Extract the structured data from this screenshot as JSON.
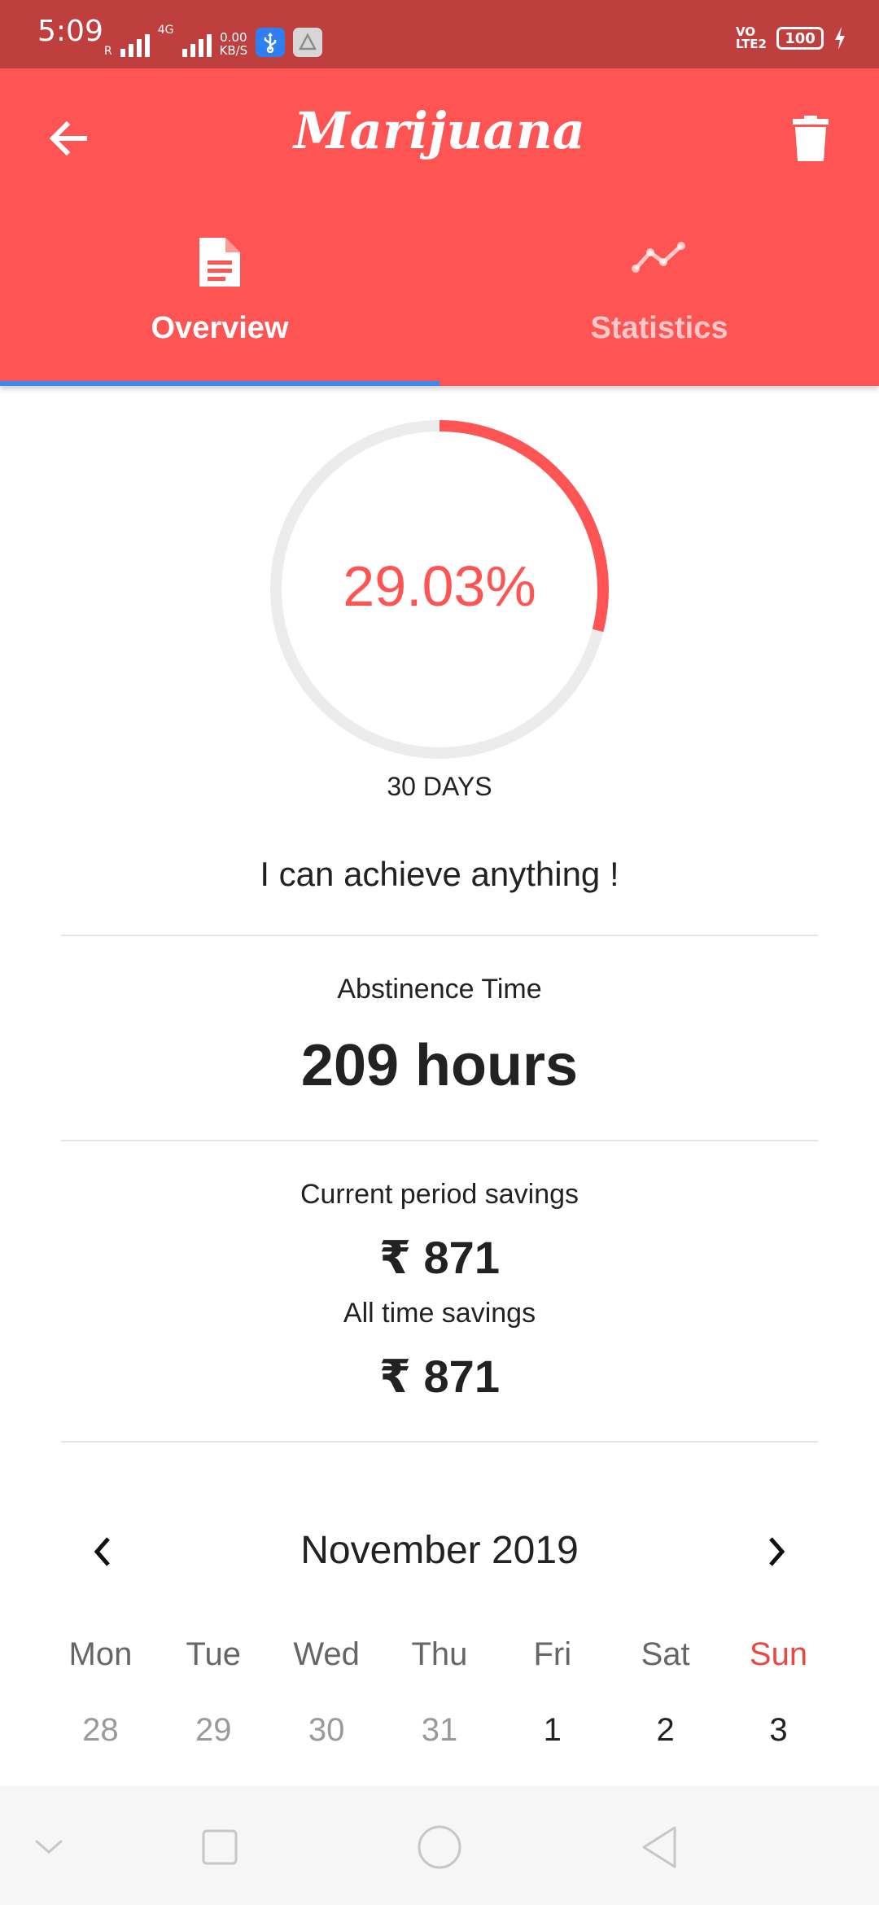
{
  "status_bar": {
    "time": "5:09",
    "sim1_label": "R",
    "network_type": "4G",
    "speed_value": "0.00",
    "speed_unit": "KB/S",
    "volte": "VO",
    "volte_sub": "LTE2",
    "battery": "100"
  },
  "app_bar": {
    "title": "Marijuana",
    "tabs": [
      {
        "label": "Overview",
        "icon": "document-icon",
        "active": true
      },
      {
        "label": "Statistics",
        "icon": "line-chart-icon",
        "active": false
      }
    ],
    "indicator_color": "#3c8af0",
    "background_color": "#fe5454"
  },
  "progress": {
    "percent_text": "29.03%",
    "percent_value": 29.03,
    "goal_label": "30 DAYS"
  },
  "motto": "I can achieve anything !",
  "abstinence": {
    "label": "Abstinence Time",
    "value": "209 hours"
  },
  "savings": {
    "current_label": "Current period savings",
    "current_value": "₹ 871",
    "all_time_label": "All time savings",
    "all_time_value": "₹ 871"
  },
  "calendar": {
    "month": "November 2019",
    "weekdays": [
      "Mon",
      "Tue",
      "Wed",
      "Thu",
      "Fri",
      "Sat",
      "Sun"
    ],
    "days": [
      "28",
      "29",
      "30",
      "31",
      "1",
      "2",
      "3"
    ],
    "sunday_color": "#e8483f"
  }
}
